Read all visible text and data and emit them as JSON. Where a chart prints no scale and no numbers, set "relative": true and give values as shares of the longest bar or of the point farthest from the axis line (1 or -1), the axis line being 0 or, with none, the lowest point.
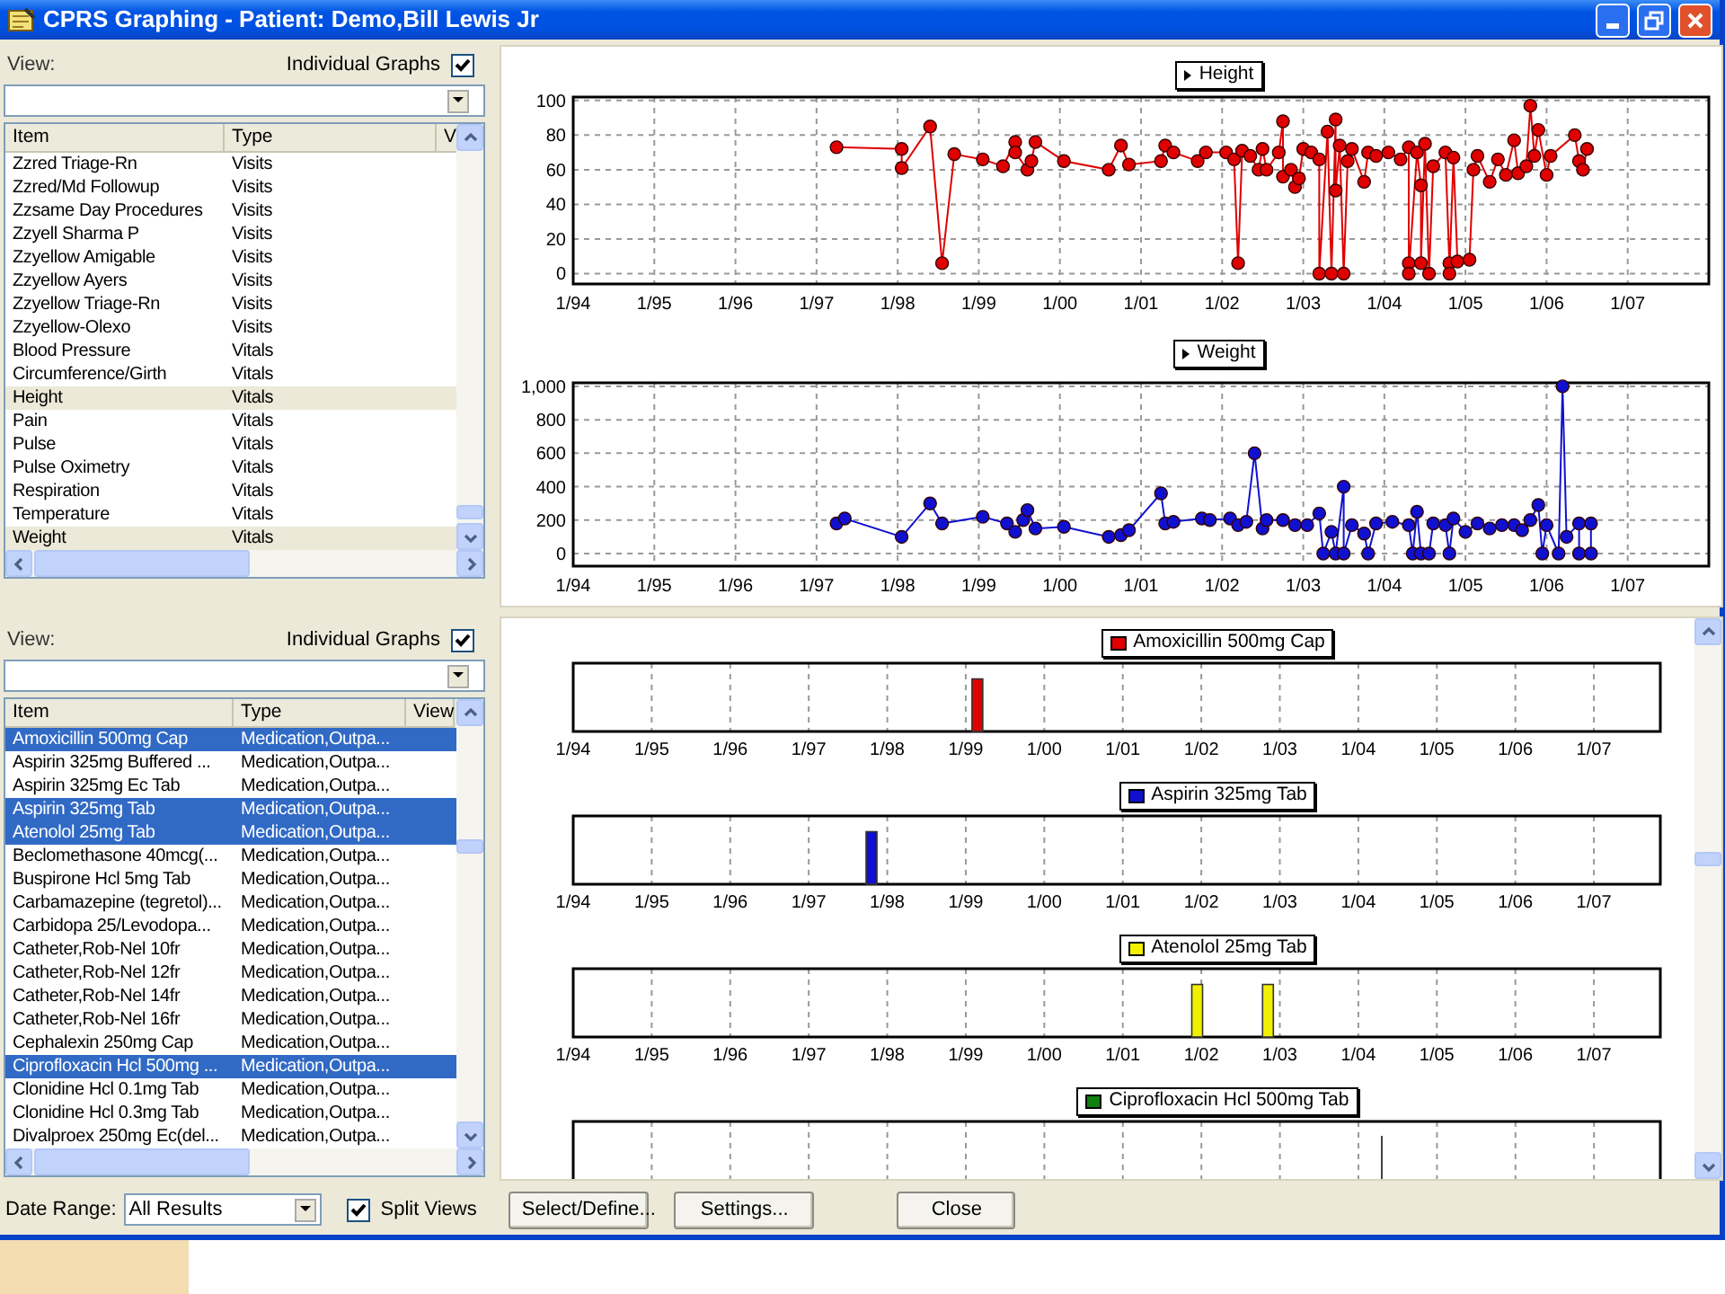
{
  "window": {
    "title": "CPRS Graphing - Patient: Demo,Bill Lewis Jr"
  },
  "panes": [
    {
      "view_label": "View:",
      "individual_graphs": {
        "label": "Individual Graphs",
        "checked": true
      },
      "list": {
        "focused": false,
        "columns": [
          "Item",
          "Type",
          "V"
        ],
        "rows": [
          {
            "cells": [
              "Zzred Triage-Rn",
              "Visits"
            ],
            "selected": false
          },
          {
            "cells": [
              "Zzred/Md Followup",
              "Visits"
            ],
            "selected": false
          },
          {
            "cells": [
              "Zzsame Day Procedures",
              "Visits"
            ],
            "selected": false
          },
          {
            "cells": [
              "Zzyell Sharma P",
              "Visits"
            ],
            "selected": false
          },
          {
            "cells": [
              "Zzyellow Amigable",
              "Visits"
            ],
            "selected": false
          },
          {
            "cells": [
              "Zzyellow Ayers",
              "Visits"
            ],
            "selected": false
          },
          {
            "cells": [
              "Zzyellow Triage-Rn",
              "Visits"
            ],
            "selected": false
          },
          {
            "cells": [
              "Zzyellow-Olexo",
              "Visits"
            ],
            "selected": false
          },
          {
            "cells": [
              "Blood Pressure",
              "Vitals"
            ],
            "selected": false
          },
          {
            "cells": [
              "Circumference/Girth",
              "Vitals"
            ],
            "selected": false
          },
          {
            "cells": [
              "Height",
              "Vitals"
            ],
            "selected": true
          },
          {
            "cells": [
              "Pain",
              "Vitals"
            ],
            "selected": false
          },
          {
            "cells": [
              "Pulse",
              "Vitals"
            ],
            "selected": false
          },
          {
            "cells": [
              "Pulse Oximetry",
              "Vitals"
            ],
            "selected": false
          },
          {
            "cells": [
              "Respiration",
              "Vitals"
            ],
            "selected": false
          },
          {
            "cells": [
              "Temperature",
              "Vitals"
            ],
            "selected": false
          },
          {
            "cells": [
              "Weight",
              "Vitals"
            ],
            "selected": true
          }
        ]
      },
      "charts": [
        {
          "kind": "chart",
          "chart_data": {
            "type": "line",
            "grid": true,
            "xlim": [
              "1994-01-01",
              "2008-01-01"
            ],
            "ylim": [
              -6,
              102
            ],
            "xticks": [
              {
                "value": "1994-01-01",
                "label": "1/94"
              },
              {
                "value": "1995-01-01",
                "label": "1/95"
              },
              {
                "value": "1996-01-01",
                "label": "1/96"
              },
              {
                "value": "1997-01-01",
                "label": "1/97"
              },
              {
                "value": "1998-01-01",
                "label": "1/98"
              },
              {
                "value": "1999-01-01",
                "label": "1/99"
              },
              {
                "value": "2000-01-01",
                "label": "1/00"
              },
              {
                "value": "2001-01-01",
                "label": "1/01"
              },
              {
                "value": "2002-01-01",
                "label": "1/02"
              },
              {
                "value": "2003-01-01",
                "label": "1/03"
              },
              {
                "value": "2004-01-01",
                "label": "1/04"
              },
              {
                "value": "2005-01-01",
                "label": "1/05"
              },
              {
                "value": "2006-01-01",
                "label": "1/06"
              },
              {
                "value": "2007-01-01",
                "label": "1/07"
              }
            ],
            "yticks": [
              0,
              20,
              40,
              60,
              80,
              100
            ],
            "x": [
              "1997-04-01",
              "1998-01-19",
              "1998-01-19",
              "1998-05-27",
              "1998-07-20",
              "1998-09-13",
              "1999-01-19",
              "1999-04-20",
              "1999-06-14",
              "1999-06-14",
              "1999-08-08",
              "1999-08-26",
              "1999-09-13",
              "2000-01-19",
              "2000-08-08",
              "2000-10-02",
              "2000-11-07",
              "2001-04-01",
              "2001-04-20",
              "2001-05-27",
              "2001-09-13",
              "2001-10-20",
              "2002-01-19",
              "2002-02-24",
              "2002-03-14",
              "2002-04-01",
              "2002-05-08",
              "2002-06-14",
              "2002-07-02",
              "2002-07-20",
              "2002-09-13",
              "2002-10-02",
              "2002-10-02",
              "2002-11-07",
              "2002-11-25",
              "2002-12-13",
              "2003-01-01",
              "2003-02-06",
              "2003-03-14",
              "2003-03-14",
              "2003-04-20",
              "2003-05-08",
              "2003-05-27",
              "2003-05-27",
              "2003-06-14",
              "2003-07-02",
              "2003-07-20",
              "2003-08-08",
              "2003-10-02",
              "2003-10-20",
              "2003-11-25",
              "2004-01-19",
              "2004-03-14",
              "2004-04-20",
              "2004-04-20",
              "2004-04-20",
              "2004-05-27",
              "2004-06-14",
              "2004-06-14",
              "2004-07-02",
              "2004-07-20",
              "2004-08-08",
              "2004-10-02",
              "2004-10-20",
              "2004-10-20",
              "2004-11-07",
              "2004-11-25",
              "2005-01-19",
              "2005-02-06",
              "2005-02-24",
              "2005-04-20",
              "2005-05-27",
              "2005-07-02",
              "2005-08-08",
              "2005-08-26",
              "2005-10-02",
              "2005-10-20",
              "2005-11-07",
              "2005-11-25",
              "2006-01-01",
              "2006-01-19",
              "2006-05-08",
              "2006-05-27",
              "2006-06-14",
              "2006-07-02"
            ],
            "series": [
              {
                "name": "Height",
                "color": "#e00000",
                "marker": "circle",
                "values": [
                  73,
                  72,
                  61,
                  85,
                  6,
                  69,
                  66,
                  62,
                  76,
                  70,
                  60,
                  65,
                  76,
                  65,
                  60,
                  74,
                  63,
                  65,
                  74,
                  70,
                  65,
                  70,
                  70,
                  66,
                  6,
                  71,
                  68,
                  60,
                  72,
                  60,
                  70,
                  88,
                  56,
                  60,
                  50,
                  55,
                  72,
                  70,
                  66,
                  0,
                  82,
                  0,
                  89,
                  48,
                  74,
                  0,
                  65,
                  72,
                  53,
                  70,
                  68,
                  70,
                  66,
                  73,
                  6,
                  0,
                  70,
                  51,
                  6,
                  75,
                  0,
                  62,
                  70,
                  6,
                  0,
                  67,
                  7,
                  8,
                  60,
                  68,
                  53,
                  66,
                  57,
                  77,
                  58,
                  62,
                  97,
                  68,
                  83,
                  57,
                  68,
                  80,
                  65,
                  60,
                  72
                ]
              }
            ]
          }
        },
        {
          "kind": "chart",
          "chart_data": {
            "type": "line",
            "grid": true,
            "xlim": [
              "1994-01-01",
              "2008-01-01"
            ],
            "ylim": [
              -75,
              1021
            ],
            "xticks": [
              {
                "value": "1994-01-01",
                "label": "1/94"
              },
              {
                "value": "1995-01-01",
                "label": "1/95"
              },
              {
                "value": "1996-01-01",
                "label": "1/96"
              },
              {
                "value": "1997-01-01",
                "label": "1/97"
              },
              {
                "value": "1998-01-01",
                "label": "1/98"
              },
              {
                "value": "1999-01-01",
                "label": "1/99"
              },
              {
                "value": "2000-01-01",
                "label": "1/00"
              },
              {
                "value": "2001-01-01",
                "label": "1/01"
              },
              {
                "value": "2002-01-01",
                "label": "1/02"
              },
              {
                "value": "2003-01-01",
                "label": "1/03"
              },
              {
                "value": "2004-01-01",
                "label": "1/04"
              },
              {
                "value": "2005-01-01",
                "label": "1/05"
              },
              {
                "value": "2006-01-01",
                "label": "1/06"
              },
              {
                "value": "2007-01-01",
                "label": "1/07"
              }
            ],
            "yticks": [
              0,
              200,
              400,
              600,
              800,
              {
                "value": 1000,
                "label": "1,000"
              }
            ],
            "x": [
              "1997-04-01",
              "1997-05-08",
              "1998-01-19",
              "1998-05-27",
              "1998-07-20",
              "1999-01-19",
              "1999-05-08",
              "1999-06-14",
              "1999-07-20",
              "1999-08-08",
              "1999-09-13",
              "2000-01-19",
              "2000-08-08",
              "2000-10-02",
              "2000-11-07",
              "2001-04-01",
              "2001-04-20",
              "2001-05-27",
              "2001-10-02",
              "2001-11-07",
              "2002-02-06",
              "2002-03-14",
              "2002-04-20",
              "2002-05-27",
              "2002-07-02",
              "2002-07-20",
              "2002-10-02",
              "2002-11-25",
              "2003-01-19",
              "2003-03-14",
              "2003-04-01",
              "2003-05-08",
              "2003-05-27",
              "2003-07-02",
              "2003-07-02",
              "2003-08-08",
              "2003-10-02",
              "2003-10-20",
              "2003-11-25",
              "2004-02-06",
              "2004-04-20",
              "2004-05-08",
              "2004-05-27",
              "2004-06-14",
              "2004-07-20",
              "2004-08-08",
              "2004-10-02",
              "2004-10-20",
              "2004-11-07",
              "2005-01-01",
              "2005-02-24",
              "2005-04-20",
              "2005-06-14",
              "2005-08-08",
              "2005-09-13",
              "2005-10-20",
              "2005-11-25",
              "2005-12-13",
              "2006-01-01",
              "2006-02-24",
              "2006-03-14",
              "2006-04-01",
              "2006-05-27",
              "2006-05-27",
              "2006-07-20",
              "2006-07-20"
            ],
            "series": [
              {
                "name": "Weight",
                "color": "#1010d0",
                "marker": "circle",
                "values": [
                  180,
                  210,
                  100,
                  300,
                  180,
                  220,
                  180,
                  130,
                  200,
                  260,
                  150,
                  160,
                  100,
                  110,
                  140,
                  360,
                  180,
                  190,
                  210,
                  200,
                  210,
                  170,
                  190,
                  600,
                  150,
                  200,
                  200,
                  170,
                  170,
                  240,
                  0,
                  130,
                  0,
                  400,
                  0,
                  170,
                  120,
                  0,
                  180,
                  190,
                  170,
                  0,
                  250,
                  0,
                  0,
                  180,
                  170,
                  0,
                  210,
                  130,
                  180,
                  150,
                  170,
                  170,
                  140,
                  200,
                  290,
                  0,
                  170,
                  0,
                  1000,
                  100,
                  180,
                  0,
                  0,
                  180
                ]
              }
            ]
          }
        }
      ]
    },
    {
      "view_label": "View:",
      "individual_graphs": {
        "label": "Individual Graphs",
        "checked": true
      },
      "list": {
        "focused": true,
        "columns": [
          "Item",
          "Type",
          "View"
        ],
        "rows": [
          {
            "cells": [
              "Amoxicillin 500mg Cap",
              "Medication,Outpa..."
            ],
            "selected": true
          },
          {
            "cells": [
              "Aspirin 325mg Buffered ...",
              "Medication,Outpa..."
            ],
            "selected": false
          },
          {
            "cells": [
              "Aspirin 325mg Ec Tab",
              "Medication,Outpa..."
            ],
            "selected": false
          },
          {
            "cells": [
              "Aspirin 325mg Tab",
              "Medication,Outpa..."
            ],
            "selected": true
          },
          {
            "cells": [
              "Atenolol 25mg Tab",
              "Medication,Outpa..."
            ],
            "selected": true
          },
          {
            "cells": [
              "Beclomethasone 40mcg(...",
              "Medication,Outpa..."
            ],
            "selected": false
          },
          {
            "cells": [
              "Buspirone Hcl 5mg Tab",
              "Medication,Outpa..."
            ],
            "selected": false
          },
          {
            "cells": [
              "Carbamazepine (tegretol)...",
              "Medication,Outpa..."
            ],
            "selected": false
          },
          {
            "cells": [
              "Carbidopa 25/Levodopa...",
              "Medication,Outpa..."
            ],
            "selected": false
          },
          {
            "cells": [
              "Catheter,Rob-Nel 10fr",
              "Medication,Outpa..."
            ],
            "selected": false
          },
          {
            "cells": [
              "Catheter,Rob-Nel 12fr",
              "Medication,Outpa..."
            ],
            "selected": false
          },
          {
            "cells": [
              "Catheter,Rob-Nel 14fr",
              "Medication,Outpa..."
            ],
            "selected": false
          },
          {
            "cells": [
              "Catheter,Rob-Nel 16fr",
              "Medication,Outpa..."
            ],
            "selected": false
          },
          {
            "cells": [
              "Cephalexin 250mg Cap",
              "Medication,Outpa..."
            ],
            "selected": false
          },
          {
            "cells": [
              "Ciprofloxacin Hcl 500mg ...",
              "Medication,Outpa..."
            ],
            "selected": true
          },
          {
            "cells": [
              "Clonidine Hcl 0.1mg Tab",
              "Medication,Outpa..."
            ],
            "selected": false
          },
          {
            "cells": [
              "Clonidine Hcl 0.3mg Tab",
              "Medication,Outpa..."
            ],
            "selected": false
          },
          {
            "cells": [
              "Divalproex 250mg Ec(del...",
              "Medication,Outpa..."
            ],
            "selected": false
          }
        ]
      },
      "charts": [
        {
          "kind": "chart",
          "chart_data": {
            "type": "bar",
            "grid": true,
            "relative": true,
            "xlim": [
              "1994-01-01",
              "2007-11-06"
            ],
            "ylim": [
              0,
              1.3
            ],
            "xticks": [
              {
                "value": "1994-01-01",
                "label": "1/94"
              },
              {
                "value": "1995-01-01",
                "label": "1/95"
              },
              {
                "value": "1996-01-01",
                "label": "1/96"
              },
              {
                "value": "1997-01-01",
                "label": "1/97"
              },
              {
                "value": "1998-01-01",
                "label": "1/98"
              },
              {
                "value": "1999-01-01",
                "label": "1/99"
              },
              {
                "value": "2000-01-01",
                "label": "1/00"
              },
              {
                "value": "2001-01-01",
                "label": "1/01"
              },
              {
                "value": "2002-01-01",
                "label": "1/02"
              },
              {
                "value": "2003-01-01",
                "label": "1/03"
              },
              {
                "value": "2004-01-01",
                "label": "1/04"
              },
              {
                "value": "2005-01-01",
                "label": "1/05"
              },
              {
                "value": "2006-01-01",
                "label": "1/06"
              },
              {
                "value": "2007-01-01",
                "label": "1/07"
              }
            ],
            "x": [
              "1999-02-24"
            ],
            "series": [
              {
                "name": "Amoxicillin 500mg Cap",
                "color": "#e00000",
                "values": [
                  1
                ]
              }
            ]
          }
        },
        {
          "kind": "chart",
          "chart_data": {
            "type": "bar",
            "grid": true,
            "relative": true,
            "xlim": [
              "1994-01-01",
              "2007-11-06"
            ],
            "ylim": [
              0,
              1.3
            ],
            "xticks": [
              {
                "value": "1994-01-01",
                "label": "1/94"
              },
              {
                "value": "1995-01-01",
                "label": "1/95"
              },
              {
                "value": "1996-01-01",
                "label": "1/96"
              },
              {
                "value": "1997-01-01",
                "label": "1/97"
              },
              {
                "value": "1998-01-01",
                "label": "1/98"
              },
              {
                "value": "1999-01-01",
                "label": "1/99"
              },
              {
                "value": "2000-01-01",
                "label": "1/00"
              },
              {
                "value": "2001-01-01",
                "label": "1/01"
              },
              {
                "value": "2002-01-01",
                "label": "1/02"
              },
              {
                "value": "2003-01-01",
                "label": "1/03"
              },
              {
                "value": "2004-01-01",
                "label": "1/04"
              },
              {
                "value": "2005-01-01",
                "label": "1/05"
              },
              {
                "value": "2006-01-01",
                "label": "1/06"
              },
              {
                "value": "2007-01-01",
                "label": "1/07"
              }
            ],
            "x": [
              "1997-10-20"
            ],
            "series": [
              {
                "name": "Aspirin 325mg Tab",
                "color": "#1010d0",
                "values": [
                  1
                ]
              }
            ]
          }
        },
        {
          "kind": "chart",
          "chart_data": {
            "type": "bar",
            "grid": true,
            "relative": true,
            "xlim": [
              "1994-01-01",
              "2007-11-06"
            ],
            "ylim": [
              0,
              1.3
            ],
            "xticks": [
              {
                "value": "1994-01-01",
                "label": "1/94"
              },
              {
                "value": "1995-01-01",
                "label": "1/95"
              },
              {
                "value": "1996-01-01",
                "label": "1/96"
              },
              {
                "value": "1997-01-01",
                "label": "1/97"
              },
              {
                "value": "1998-01-01",
                "label": "1/98"
              },
              {
                "value": "1999-01-01",
                "label": "1/99"
              },
              {
                "value": "2000-01-01",
                "label": "1/00"
              },
              {
                "value": "2001-01-01",
                "label": "1/01"
              },
              {
                "value": "2002-01-01",
                "label": "1/02"
              },
              {
                "value": "2003-01-01",
                "label": "1/03"
              },
              {
                "value": "2004-01-01",
                "label": "1/04"
              },
              {
                "value": "2005-01-01",
                "label": "1/05"
              },
              {
                "value": "2006-01-01",
                "label": "1/06"
              },
              {
                "value": "2007-01-01",
                "label": "1/07"
              }
            ],
            "x": [
              "2001-12-13",
              "2002-11-07"
            ],
            "series": [
              {
                "name": "Atenolol 25mg Tab",
                "color": "#f0f000",
                "values": [
                  1,
                  1
                ]
              }
            ]
          }
        },
        {
          "kind": "strip",
          "legend": {
            "name": "Ciprofloxacin Hcl 500mg Tab",
            "color": "#108010"
          }
        }
      ]
    }
  ],
  "bottom_bar": {
    "date_range": {
      "label": "Date Range:",
      "value": "All Results"
    },
    "split_views": {
      "label": "Split Views",
      "checked": true
    },
    "buttons": [
      "Select/Define...",
      "Settings...",
      "Close"
    ]
  }
}
